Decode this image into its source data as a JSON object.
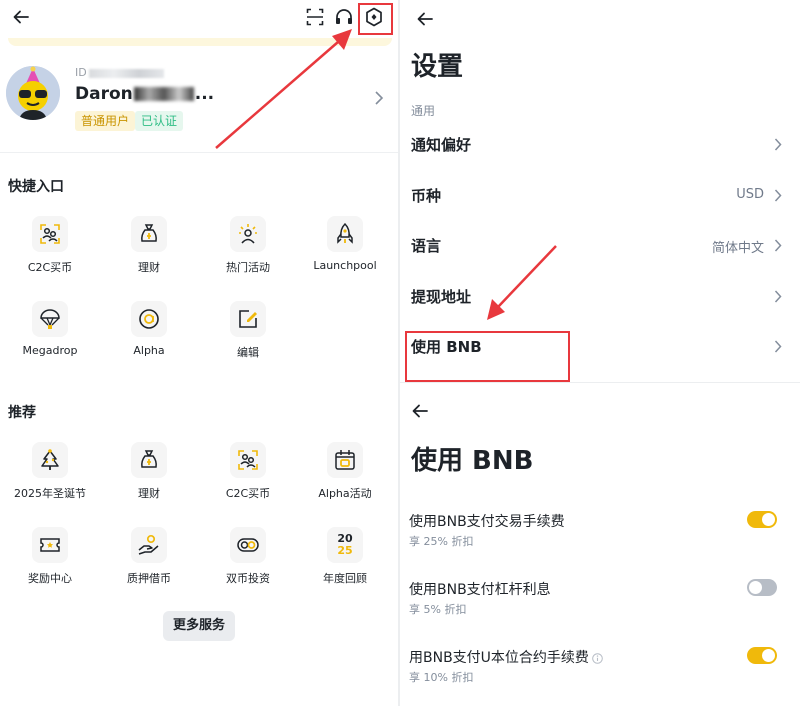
{
  "account": {
    "uid_prefix": "ID",
    "username_start": "Daron",
    "username_end": "...",
    "badges": {
      "normal": "普通用户",
      "verified": "已认证"
    }
  },
  "shortcuts": {
    "title": "快捷入口",
    "items": [
      {
        "label": "C2C买币",
        "icon": "c2c-icon"
      },
      {
        "label": "理财",
        "icon": "earn-bag-icon"
      },
      {
        "label": "热门活动",
        "icon": "hot-activity-icon"
      },
      {
        "label": "Launchpool",
        "icon": "rocket-icon"
      },
      {
        "label": "Megadrop",
        "icon": "parachute-icon"
      },
      {
        "label": "Alpha",
        "icon": "alpha-icon"
      },
      {
        "label": "编辑",
        "icon": "edit-icon"
      }
    ]
  },
  "recommended": {
    "title": "推荐",
    "items": [
      {
        "label": "2025年圣诞节",
        "icon": "christmas-tree-icon"
      },
      {
        "label": "理财",
        "icon": "earn-bag-icon"
      },
      {
        "label": "C2C买币",
        "icon": "c2c-icon"
      },
      {
        "label": "Alpha活动",
        "icon": "calendar-alpha-icon"
      },
      {
        "label": "奖励中心",
        "icon": "ticket-icon"
      },
      {
        "label": "质押借币",
        "icon": "pledge-hand-icon"
      },
      {
        "label": "双币投资",
        "icon": "dual-coin-icon"
      },
      {
        "label": "年度回顾",
        "icon": "year-2025-icon"
      }
    ],
    "year_badge": {
      "top": "20",
      "bottom": "25"
    }
  },
  "more_services": "更多服务",
  "settings": {
    "title": "设置",
    "group": "通用",
    "rows": [
      {
        "label": "通知偏好",
        "value": ""
      },
      {
        "label": "币种",
        "value": "USD"
      },
      {
        "label": "语言",
        "value": "简体中文"
      },
      {
        "label": "提现地址",
        "value": ""
      },
      {
        "label": "使用 BNB",
        "value": ""
      }
    ]
  },
  "use_bnb": {
    "title": "使用 BNB",
    "options": [
      {
        "label": "使用BNB支付交易手续费",
        "sub": "享 25% 折扣",
        "enabled": true
      },
      {
        "label": "使用BNB支付杠杆利息",
        "sub": "享 5% 折扣",
        "enabled": false
      },
      {
        "label": "用BNB支付U本位合约手续费",
        "sub": "享 10% 折扣",
        "enabled": true
      }
    ]
  },
  "colors": {
    "accent": "#f0b90b",
    "annotation": "#e8383d",
    "verified": "#2ebd85"
  }
}
